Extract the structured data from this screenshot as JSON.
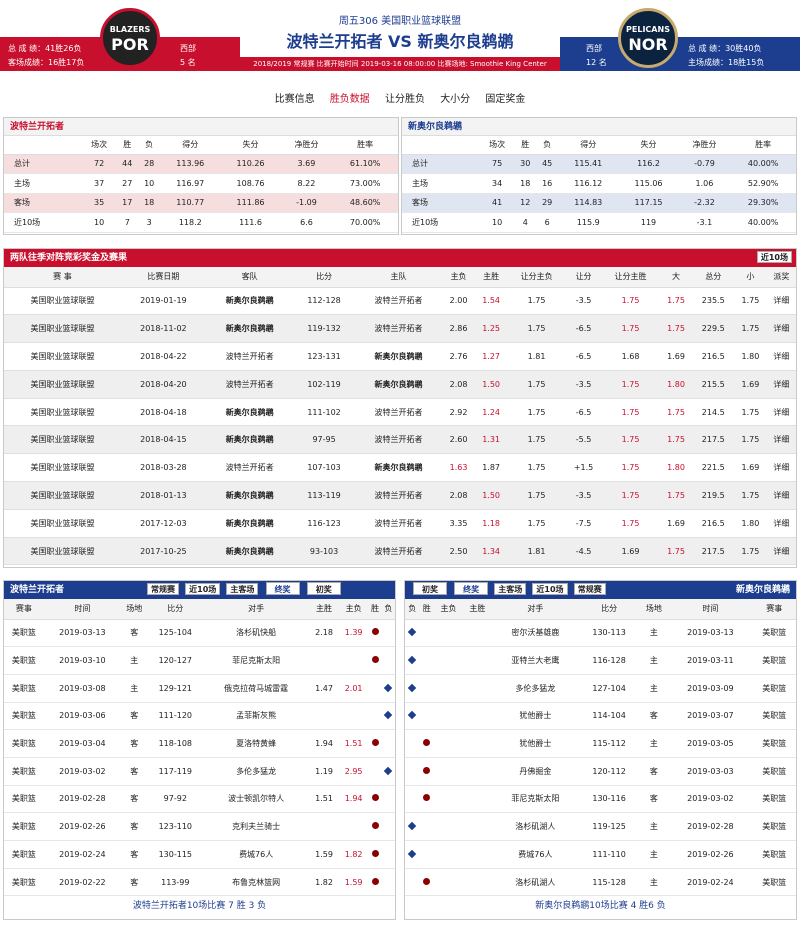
{
  "header": {
    "match_title": "周五306 美国职业篮球联盟",
    "home_team": "波特兰开拓者",
    "vs": "VS",
    "away_team": "新奥尔良鹈鹕",
    "info": "2018/2019 常规赛 比赛开始时间 2019-03-16 08:00:00 比赛场地: Smoothie King Center",
    "left": {
      "logo_top": "BLAZERS",
      "logo_abbr": "POR",
      "total": "总 成 绩：41胜26负",
      "away": "客场成绩：16胜17负",
      "conf": "西部",
      "rank": "5 名"
    },
    "right": {
      "logo_top": "PELICANS",
      "logo_abbr": "NOR",
      "total": "总 成 绩：30胜40负",
      "home": "主场成绩：18胜15负",
      "conf": "西部",
      "rank": "12 名"
    }
  },
  "nav": [
    "比赛信息",
    "胜负数据",
    "让分胜负",
    "大小分",
    "固定奖金"
  ],
  "stats": {
    "headers": [
      "",
      "场次",
      "胜",
      "负",
      "得分",
      "失分",
      "净胜分",
      "胜率"
    ],
    "left_title": "波特兰开拓者",
    "right_title": "新奥尔良鹈鹕",
    "left_rows": [
      [
        "总计",
        "72",
        "44",
        "28",
        "113.96",
        "110.26",
        "3.69",
        "61.10%"
      ],
      [
        "主场",
        "37",
        "27",
        "10",
        "116.97",
        "108.76",
        "8.22",
        "73.00%"
      ],
      [
        "客场",
        "35",
        "17",
        "18",
        "110.77",
        "111.86",
        "-1.09",
        "48.60%"
      ],
      [
        "近10场",
        "10",
        "7",
        "3",
        "118.2",
        "111.6",
        "6.6",
        "70.00%"
      ]
    ],
    "right_rows": [
      [
        "总计",
        "75",
        "30",
        "45",
        "115.41",
        "116.2",
        "-0.79",
        "40.00%"
      ],
      [
        "主场",
        "34",
        "18",
        "16",
        "116.12",
        "115.06",
        "1.06",
        "52.90%"
      ],
      [
        "客场",
        "41",
        "12",
        "29",
        "114.83",
        "117.15",
        "-2.32",
        "29.30%"
      ],
      [
        "近10场",
        "10",
        "4",
        "6",
        "115.9",
        "119",
        "-3.1",
        "40.00%"
      ]
    ]
  },
  "h2h": {
    "title": "两队往季对阵竞彩奖金及赛果",
    "select": "近10场",
    "headers": [
      "赛 事",
      "比赛日期",
      "客队",
      "比分",
      "主队",
      "主负",
      "主胜",
      "让分主负",
      "让分",
      "让分主胜",
      "大",
      "总分",
      "小",
      "派奖"
    ],
    "rows": [
      [
        "美国职业篮球联盟",
        "2019-01-19",
        "新奥尔良鹈鹕",
        "112-128",
        "波特兰开拓者",
        "2.00",
        "1.54",
        "1.75",
        "-3.5",
        "1.75",
        "1.75",
        "235.5",
        "1.75",
        "详细"
      ],
      [
        "美国职业篮球联盟",
        "2018-11-02",
        "新奥尔良鹈鹕",
        "119-132",
        "波特兰开拓者",
        "2.86",
        "1.25",
        "1.75",
        "-6.5",
        "1.75",
        "1.75",
        "229.5",
        "1.75",
        "详细"
      ],
      [
        "美国职业篮球联盟",
        "2018-04-22",
        "波特兰开拓者",
        "123-131",
        "新奥尔良鹈鹕",
        "2.76",
        "1.27",
        "1.81",
        "-6.5",
        "1.68",
        "1.69",
        "216.5",
        "1.80",
        "详细"
      ],
      [
        "美国职业篮球联盟",
        "2018-04-20",
        "波特兰开拓者",
        "102-119",
        "新奥尔良鹈鹕",
        "2.08",
        "1.50",
        "1.75",
        "-3.5",
        "1.75",
        "1.80",
        "215.5",
        "1.69",
        "详细"
      ],
      [
        "美国职业篮球联盟",
        "2018-04-18",
        "新奥尔良鹈鹕",
        "111-102",
        "波特兰开拓者",
        "2.92",
        "1.24",
        "1.75",
        "-6.5",
        "1.75",
        "1.75",
        "214.5",
        "1.75",
        "详细"
      ],
      [
        "美国职业篮球联盟",
        "2018-04-15",
        "新奥尔良鹈鹕",
        "97-95",
        "波特兰开拓者",
        "2.60",
        "1.31",
        "1.75",
        "-5.5",
        "1.75",
        "1.75",
        "217.5",
        "1.75",
        "详细"
      ],
      [
        "美国职业篮球联盟",
        "2018-03-28",
        "波特兰开拓者",
        "107-103",
        "新奥尔良鹈鹕",
        "1.63",
        "1.87",
        "1.75",
        "+1.5",
        "1.75",
        "1.80",
        "221.5",
        "1.69",
        "详细"
      ],
      [
        "美国职业篮球联盟",
        "2018-01-13",
        "新奥尔良鹈鹕",
        "113-119",
        "波特兰开拓者",
        "2.08",
        "1.50",
        "1.75",
        "-3.5",
        "1.75",
        "1.75",
        "219.5",
        "1.75",
        "详细"
      ],
      [
        "美国职业篮球联盟",
        "2017-12-03",
        "新奥尔良鹈鹕",
        "116-123",
        "波特兰开拓者",
        "3.35",
        "1.18",
        "1.75",
        "-7.5",
        "1.75",
        "1.69",
        "216.5",
        "1.80",
        "详细"
      ],
      [
        "美国职业篮球联盟",
        "2017-10-25",
        "新奥尔良鹈鹕",
        "93-103",
        "波特兰开拓者",
        "2.50",
        "1.34",
        "1.81",
        "-4.5",
        "1.69",
        "1.75",
        "217.5",
        "1.75",
        "详细"
      ]
    ],
    "red_cols": [
      5,
      6,
      9,
      10
    ]
  },
  "recent": {
    "left": {
      "title": "波特兰开拓者",
      "filters": [
        "常规赛",
        "近10场",
        "主客场"
      ],
      "buttons": [
        "终奖",
        "初奖"
      ],
      "headers": [
        "赛事",
        "时间",
        "场地",
        "比分",
        "对手",
        "主胜",
        "主负",
        "胜",
        "负"
      ],
      "rows": [
        [
          "美职篮",
          "2019-03-13",
          "客",
          "125-104",
          "洛杉矶快船",
          "2.18",
          "1.39",
          "W"
        ],
        [
          "美职篮",
          "2019-03-10",
          "主",
          "120-127",
          "菲尼克斯太阳",
          "",
          "",
          "W"
        ],
        [
          "美职篮",
          "2019-03-08",
          "主",
          "129-121",
          "俄克拉荷马城雷霆",
          "1.47",
          "2.01",
          "L"
        ],
        [
          "美职篮",
          "2019-03-06",
          "客",
          "111-120",
          "孟菲斯灰熊",
          "",
          "",
          "L"
        ],
        [
          "美职篮",
          "2019-03-04",
          "客",
          "118-108",
          "夏洛特黄蜂",
          "1.94",
          "1.51",
          "W"
        ],
        [
          "美职篮",
          "2019-03-02",
          "客",
          "117-119",
          "多伦多猛龙",
          "1.19",
          "2.95",
          "L"
        ],
        [
          "美职篮",
          "2019-02-28",
          "客",
          "97-92",
          "波士顿凯尔特人",
          "1.51",
          "1.94",
          "W"
        ],
        [
          "美职篮",
          "2019-02-26",
          "客",
          "123-110",
          "克利夫兰骑士",
          "",
          "",
          "W"
        ],
        [
          "美职篮",
          "2019-02-24",
          "客",
          "130-115",
          "费城76人",
          "1.59",
          "1.82",
          "W"
        ],
        [
          "美职篮",
          "2019-02-22",
          "客",
          "113-99",
          "布鲁克林篮网",
          "1.82",
          "1.59",
          "W"
        ]
      ],
      "summary": "波特兰开拓者10场比赛 7 胜 3 负"
    },
    "right": {
      "title": "新奥尔良鹈鹕",
      "filters": [
        "主客场",
        "近10场",
        "常规赛"
      ],
      "buttons": [
        "初奖",
        "终奖"
      ],
      "headers": [
        "负",
        "胜",
        "主负",
        "主胜",
        "对手",
        "比分",
        "场地",
        "时间",
        "赛事"
      ],
      "rows": [
        [
          "L",
          "",
          "",
          "",
          "密尔沃基雄鹿",
          "130-113",
          "主",
          "2019-03-13",
          "美职篮"
        ],
        [
          "L",
          "",
          "",
          "",
          "亚特兰大老鹰",
          "116-128",
          "主",
          "2019-03-11",
          "美职篮"
        ],
        [
          "L",
          "",
          "",
          "",
          "多伦多猛龙",
          "127-104",
          "主",
          "2019-03-09",
          "美职篮"
        ],
        [
          "L",
          "",
          "",
          "",
          "犹他爵士",
          "114-104",
          "客",
          "2019-03-07",
          "美职篮"
        ],
        [
          "W",
          "",
          "",
          "",
          "犹他爵士",
          "115-112",
          "主",
          "2019-03-05",
          "美职篮"
        ],
        [
          "W",
          "",
          "",
          "",
          "丹佛掘金",
          "120-112",
          "客",
          "2019-03-03",
          "美职篮"
        ],
        [
          "W",
          "",
          "",
          "",
          "菲尼克斯太阳",
          "130-116",
          "客",
          "2019-03-02",
          "美职篮"
        ],
        [
          "L",
          "",
          "",
          "",
          "洛杉矶湖人",
          "119-125",
          "主",
          "2019-02-28",
          "美职篮"
        ],
        [
          "L",
          "",
          "",
          "",
          "费城76人",
          "111-110",
          "主",
          "2019-02-26",
          "美职篮"
        ],
        [
          "W",
          "",
          "",
          "",
          "洛杉矶湖人",
          "115-128",
          "主",
          "2019-02-24",
          "美职篮"
        ]
      ],
      "summary": "新奥尔良鹈鹕10场比赛 4 胜6 负"
    }
  }
}
